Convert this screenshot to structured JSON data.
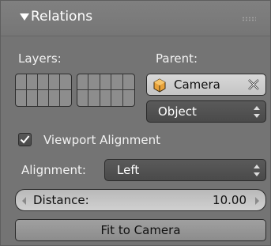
{
  "panel": {
    "title": "Relations",
    "collapse_icon": "triangle-down-icon",
    "grip_icon": "drag-grip-icon"
  },
  "layers": {
    "label": "Layers:"
  },
  "parent": {
    "label": "Parent:",
    "object_name": "Camera",
    "object_icon": "camera-object-icon",
    "clear_icon": "x-clear-icon",
    "parent_type": "Object"
  },
  "viewport_alignment": {
    "label": "Viewport Alignment",
    "checked": true
  },
  "alignment": {
    "label": "Alignment:",
    "value": "Left"
  },
  "distance": {
    "label": "Distance:",
    "value": "10.00"
  },
  "fit_button": {
    "label": "Fit to Camera"
  },
  "colors": {
    "panel_bg": "#747474",
    "light_field": "#cfcfcf",
    "dark_field": "#505050",
    "camera_icon": "#e8a23a"
  }
}
